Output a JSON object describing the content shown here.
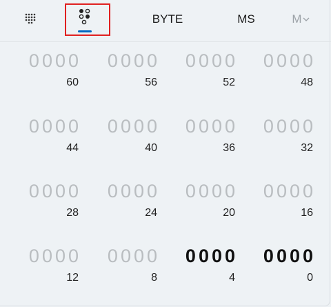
{
  "toolbar": {
    "keypad_icon": "dial-pad-icon",
    "bitflip_icon": "bit-toggling-icon",
    "word_size": "BYTE",
    "memory_store": "MS",
    "memory_menu": "M",
    "memory_menu_chevron": "chevron-down-icon"
  },
  "bit_groups": [
    {
      "bits": "0000",
      "position": "60",
      "active": false
    },
    {
      "bits": "0000",
      "position": "56",
      "active": false
    },
    {
      "bits": "0000",
      "position": "52",
      "active": false
    },
    {
      "bits": "0000",
      "position": "48",
      "active": false
    },
    {
      "bits": "0000",
      "position": "44",
      "active": false
    },
    {
      "bits": "0000",
      "position": "40",
      "active": false
    },
    {
      "bits": "0000",
      "position": "36",
      "active": false
    },
    {
      "bits": "0000",
      "position": "32",
      "active": false
    },
    {
      "bits": "0000",
      "position": "28",
      "active": false
    },
    {
      "bits": "0000",
      "position": "24",
      "active": false
    },
    {
      "bits": "0000",
      "position": "20",
      "active": false
    },
    {
      "bits": "0000",
      "position": "16",
      "active": false
    },
    {
      "bits": "0000",
      "position": "12",
      "active": false
    },
    {
      "bits": "0000",
      "position": "8",
      "active": false
    },
    {
      "bits": "0000",
      "position": "4",
      "active": true
    },
    {
      "bits": "0000",
      "position": "0",
      "active": true
    }
  ],
  "colors": {
    "accent": "#0067c0",
    "highlight": "#e02020",
    "inactive_bits": "#b9bdc0",
    "active_bits": "#111111"
  }
}
